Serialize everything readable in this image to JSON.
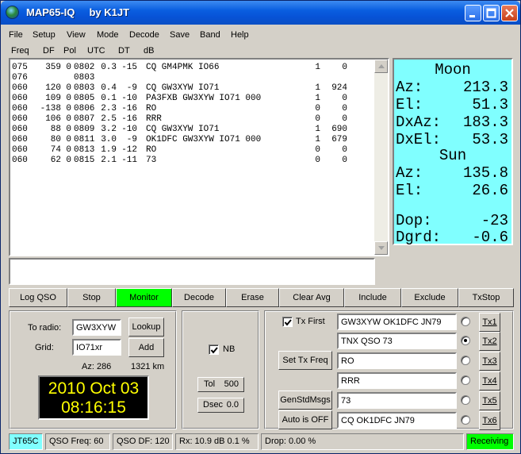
{
  "window": {
    "title": "MAP65-IQ     by K1JT"
  },
  "menu": [
    "File",
    "Setup",
    "View",
    "Mode",
    "Decode",
    "Save",
    "Band",
    "Help"
  ],
  "columns": [
    "Freq",
    "DF",
    "Pol",
    "UTC",
    "DT",
    "dB"
  ],
  "decodes": [
    {
      "freq": "075",
      "df": "359",
      "pol": "0",
      "utc": "0802",
      "dt": "0.3",
      "db": "-15",
      "msg": "CQ GM4PMK IO66",
      "sync": "1",
      "extra": "0"
    },
    {
      "freq": "076",
      "df": "",
      "pol": "",
      "utc": "0803",
      "dt": "",
      "db": "",
      "msg": "",
      "sync": "",
      "extra": ""
    },
    {
      "freq": "060",
      "df": "120",
      "pol": "0",
      "utc": "0803",
      "dt": "0.4",
      "db": "-9",
      "msg": "CQ GW3XYW IO71",
      "sync": "1",
      "extra": "924"
    },
    {
      "freq": "060",
      "df": "109",
      "pol": "0",
      "utc": "0805",
      "dt": "0.1",
      "db": "-10",
      "msg": "PA3FXB GW3XYW IO71 000",
      "sync": "1",
      "extra": "0"
    },
    {
      "freq": "060",
      "df": "-138",
      "pol": "0",
      "utc": "0806",
      "dt": "2.3",
      "db": "-16",
      "msg": "RO",
      "sync": "0",
      "extra": "0"
    },
    {
      "freq": "060",
      "df": "106",
      "pol": "0",
      "utc": "0807",
      "dt": "2.5",
      "db": "-16",
      "msg": "RRR",
      "sync": "0",
      "extra": "0"
    },
    {
      "freq": "060",
      "df": "88",
      "pol": "0",
      "utc": "0809",
      "dt": "3.2",
      "db": "-10",
      "msg": "CQ GW3XYW IO71",
      "sync": "1",
      "extra": "690"
    },
    {
      "freq": "060",
      "df": "80",
      "pol": "0",
      "utc": "0811",
      "dt": "3.0",
      "db": "-9",
      "msg": "OK1DFC GW3XYW IO71 000",
      "sync": "1",
      "extra": "679"
    },
    {
      "freq": "060",
      "df": "74",
      "pol": "0",
      "utc": "0813",
      "dt": "1.9",
      "db": "-12",
      "msg": "RO",
      "sync": "0",
      "extra": "0"
    },
    {
      "freq": "060",
      "df": "62",
      "pol": "0",
      "utc": "0815",
      "dt": "2.1",
      "db": "-11",
      "msg": "73",
      "sync": "0",
      "extra": "0"
    }
  ],
  "astro": {
    "moon_label": "Moon",
    "moon_az_label": "Az:",
    "moon_az": "213.3",
    "moon_el_label": "El:",
    "moon_el": "51.3",
    "dxaz_label": "DxAz:",
    "dxaz": "183.3",
    "dxel_label": "DxEl:",
    "dxel": "53.3",
    "sun_label": "Sun",
    "sun_az_label": "Az:",
    "sun_az": "135.8",
    "sun_el_label": "El:",
    "sun_el": "26.6",
    "dop_label": "Dop:",
    "dop": "-23",
    "dgrd_label": "Dgrd:",
    "dgrd": "-0.6",
    "bg_color": "#80ffff"
  },
  "buttons": {
    "log_qso": "Log QSO",
    "stop": "Stop",
    "monitor": "Monitor",
    "decode": "Decode",
    "erase": "Erase",
    "clear_avg": "Clear Avg",
    "include": "Include",
    "exclude": "Exclude",
    "txstop": "TxStop",
    "monitor_color": "#00ff00"
  },
  "station": {
    "to_radio_label": "To radio:",
    "to_radio": "GW3XYW",
    "grid_label": "Grid:",
    "grid": "IO71xr",
    "lookup": "Lookup",
    "add": "Add",
    "az": "Az: 286",
    "dist": "1321 km",
    "date": "2010 Oct 03",
    "time": "08:16:15"
  },
  "middle": {
    "nb_label": "NB",
    "nb_checked": true,
    "tol_label": "Tol",
    "tol": "500",
    "dsec_label": "Dsec",
    "dsec": "0.0"
  },
  "tx": {
    "tx_first_label": "Tx First",
    "tx_first_checked": true,
    "set_tx_freq": "Set Tx Freq",
    "genstdmsgs": "GenStdMsgs",
    "auto": "Auto is OFF",
    "messages": [
      "GW3XYW OK1DFC JN79",
      "TNX QSO 73",
      "RO",
      "RRR",
      "73",
      "CQ OK1DFC JN79"
    ],
    "selected": 2,
    "tx_buttons": [
      "Tx1",
      "Tx2",
      "Tx3",
      "Tx4",
      "Tx5",
      "Tx6"
    ]
  },
  "status": {
    "mode": "JT65C",
    "mode_color": "#80ffff",
    "qso_freq": "QSO Freq:  60",
    "qso_df": "QSO DF: 120",
    "rx": "Rx: 10.9 dB  0.1 %",
    "drop": "Drop: 0.00 %",
    "state": "Receiving",
    "state_color": "#00ff00"
  }
}
